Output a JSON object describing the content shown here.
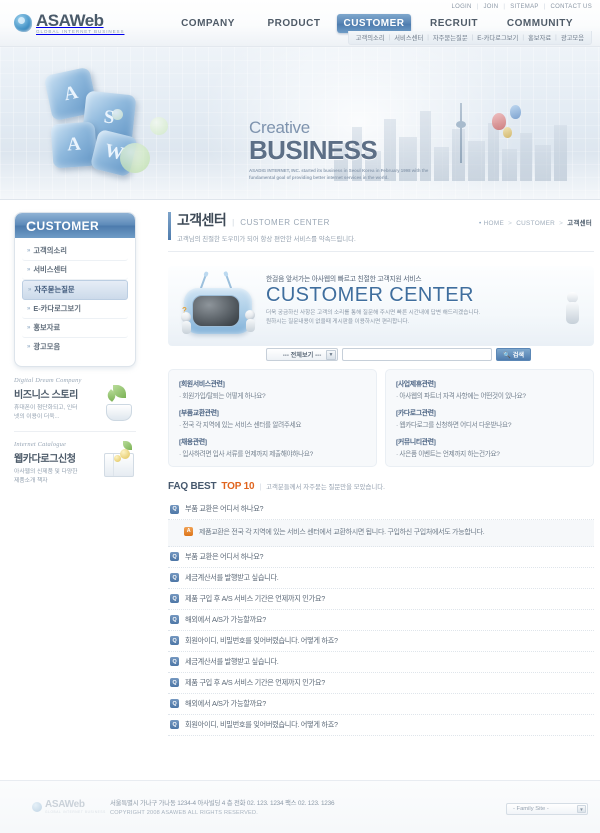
{
  "header": {
    "logo": {
      "name": "ASAWeb",
      "tagline": "GLOBAL INTERNET BUSINESS"
    },
    "util": [
      {
        "label": "LOGIN"
      },
      {
        "label": "JOIN"
      },
      {
        "label": "SITEMAP"
      },
      {
        "label": "CONTACT US"
      }
    ],
    "nav": [
      {
        "label": "COMPANY",
        "active": false
      },
      {
        "label": "PRODUCT",
        "active": false
      },
      {
        "label": "CUSTOMER",
        "active": true
      },
      {
        "label": "RECRUIT",
        "active": false
      },
      {
        "label": "COMMUNITY",
        "active": false
      }
    ],
    "subnav": [
      {
        "label": "고객의소리"
      },
      {
        "label": "서비스센터"
      },
      {
        "label": "자주묻는질문"
      },
      {
        "label": "E-카다로그보기"
      },
      {
        "label": "홍보자료"
      },
      {
        "label": "광고모음"
      }
    ]
  },
  "hero": {
    "line1": "Creative",
    "line2": "BUSINESS",
    "caption": "ASADIG INTERNET, INC. started its business in Seoul Korea in February 1998 with the fundamental goal of providing better internet services in the world.",
    "cube_letters": [
      "A",
      "S",
      "A",
      "W"
    ]
  },
  "sidebar": {
    "title": "CUSTOMER",
    "title_cap": "C",
    "title_rest": "USTOMER",
    "items": [
      {
        "label": "고객의소리",
        "active": false
      },
      {
        "label": "서비스센터",
        "active": false
      },
      {
        "label": "자주묻는질문",
        "active": true
      },
      {
        "label": "E-카다로그보기",
        "active": false
      },
      {
        "label": "홍보자료",
        "active": false
      },
      {
        "label": "광고모음",
        "active": false
      }
    ],
    "arrow": "»",
    "promos": [
      {
        "en": "Digital Dream Company",
        "kr": "비즈니스 스토리",
        "desc": "휴대폰이 첨단화되고, 인터넷의 이용이 더욱..."
      },
      {
        "en": "Internet Catalogue",
        "kr": "웹카다로그신청",
        "desc": "아사웹의 신제품 및 다양한 제품소개 책자"
      }
    ]
  },
  "page": {
    "title": "고객센터",
    "title_en": "CUSTOMER CENTER",
    "separator": "|",
    "description": "고객님의 친절한 도우미가 되어 항상 편안한 서비스를 약속드립니다.",
    "breadcrumb": {
      "dot": "•",
      "items": [
        "HOME",
        "CUSTOMER",
        "고객센터"
      ],
      "gt": ">"
    }
  },
  "customer_center": {
    "tagline": "한걸음 앞서가는 아사웹의 빠르고 친절한 고객지원 서비스",
    "tagline_bold": "고객지원",
    "heading": "CUSTOMER CENTER",
    "desc_line1": "더욱 궁금하신 사항은 고객의 소리를 통해 질문해 주시면 빠른 시간내에 답변 해드리겠습니다.",
    "desc_line1_bold": "고객의 소리",
    "desc_line2": "원하시는 질문내용이 없을때 게시판을 이용하시면 편리합니다."
  },
  "search": {
    "select_value": "--- 전체보기 ---",
    "caret": "▼",
    "input_value": "",
    "placeholder": "",
    "button_label": "검색",
    "button_icon": "🔍"
  },
  "categories": {
    "left": [
      {
        "title": "[회원서비스관련]",
        "question": "· 회원가입/탈퇴는 어떻게 하나요?"
      },
      {
        "title": "[부품교환관련]",
        "question": "· 전국 각 지역에 있는 서비스 센터를 알려주세요"
      },
      {
        "title": "[채용관련]",
        "question": "· 입사하려면 입사 서류를 언제까지 제출해야하나요?"
      }
    ],
    "right": [
      {
        "title": "[사업제휴관련]",
        "question": "· 아사웹의 파트너 자격 사항에는 어떤것이 있나요?"
      },
      {
        "title": "[카다로그관련]",
        "question": "· 웹카다로그를 신청하면 어디서 다운받나요?"
      },
      {
        "title": "[커뮤니티관련]",
        "question": "· 사은품 이벤트는 언제까지 하는건가요?"
      }
    ]
  },
  "faq": {
    "heading_1": "FAQ BEST",
    "heading_2": "TOP 10",
    "bar": "|",
    "subtitle": "고객분들께서 자주묻는 질문만을 모았습니다.",
    "q_badge": "Q",
    "a_badge": "A",
    "items": [
      {
        "type": "q",
        "text": "부품 교환은 어디서 하나요?"
      },
      {
        "type": "a",
        "text": "제품교환은 전국 각 지역에 있는 서비스 센터에서 교환하시면 됩니다. 구입하신 구입처에서도 가능합니다."
      },
      {
        "type": "q",
        "text": "부품 교환은 어디서 하나요?"
      },
      {
        "type": "q",
        "text": "세금계산서를 발행받고 싶습니다."
      },
      {
        "type": "q",
        "text": "제품 구입 후 A/S 서비스 기간은 언제까지 인가요?"
      },
      {
        "type": "q",
        "text": "해외에서 A/S가 가능할까요?"
      },
      {
        "type": "q",
        "text": "회원아이디, 비밀번호를 잊어버렸습니다. 어떻게 하죠?"
      },
      {
        "type": "q",
        "text": "세금계산서를 발행받고 싶습니다."
      },
      {
        "type": "q",
        "text": "제품 구입 후 A/S 서비스 기간은 언제까지 인가요?"
      },
      {
        "type": "q",
        "text": "해외에서 A/S가 가능할까요?"
      },
      {
        "type": "q",
        "text": "회원아이디, 비밀번호를 잊어버렸습니다. 어떻게 하죠?"
      }
    ]
  },
  "footer": {
    "logo": {
      "name": "ASAWeb",
      "tagline": "GLOBAL INTERNET BUSINESS"
    },
    "address": "서울특별시 가나구 가나동 1234-4 아사빌딩 4 층   전화 02. 123. 1234    팩스 02. 123. 1236",
    "copyright": "COPYRIGHT 2008 ASAWEB ALL RIGHTS RESERVED.",
    "family_site": "- Family Site -",
    "family_caret": "▼"
  },
  "colors": {
    "accent_blue": "#4d76a6",
    "accent_orange": "#e0641e",
    "nav_active": "#5b87b6",
    "text_dark": "#3e4a57"
  }
}
